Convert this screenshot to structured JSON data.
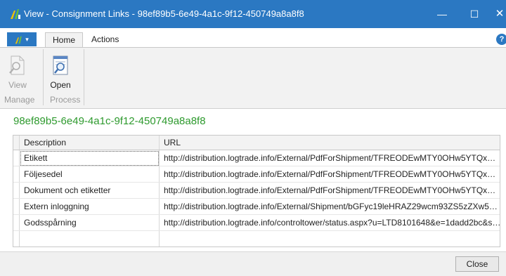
{
  "window": {
    "title": "View - Consignment Links - 98ef89b5-6e49-4a1c-9f12-450749a8a8f8",
    "minimize_glyph": "—",
    "maximize_glyph": "☐",
    "close_glyph": "✕"
  },
  "ribbon": {
    "app_button_caret": "▾",
    "tabs": [
      "Home",
      "Actions"
    ],
    "active_tab": "Home",
    "help_glyph": "?",
    "groups": [
      {
        "label": "Manage",
        "buttons": [
          {
            "label": "View",
            "icon": "document-view-icon",
            "enabled": false
          }
        ]
      },
      {
        "label": "Process",
        "buttons": [
          {
            "label": "Open",
            "icon": "open-link-icon",
            "enabled": true
          }
        ]
      }
    ]
  },
  "record": {
    "id": "98ef89b5-6e49-4a1c-9f12-450749a8a8f8"
  },
  "grid": {
    "columns": [
      "Description",
      "URL"
    ],
    "rows": [
      {
        "description": "Etikett",
        "url": "http://distribution.logtrade.info/External/PdfForShipment/TFREODEwMTY0OHw5YTQxN2I0..."
      },
      {
        "description": "Följesedel",
        "url": "http://distribution.logtrade.info/External/PdfForShipment/TFREODEwMTY0OHw5YTQxN2I0..."
      },
      {
        "description": "Dokument och etiketter",
        "url": "http://distribution.logtrade.info/External/PdfForShipment/TFREODEwMTY0OHw5YTQxN2I0..."
      },
      {
        "description": "Extern inloggning",
        "url": "http://distribution.logtrade.info/External/Shipment/bGFyc19leHRAZ29wcm93ZS5zZXw5YTQ..."
      },
      {
        "description": "Godsspårning",
        "url": "http://distribution.logtrade.info/controltower/status.aspx?u=LTD8101648&e=1dadd2bc&s=6..."
      }
    ],
    "selected_row": 0
  },
  "footer": {
    "close_label": "Close"
  },
  "colors": {
    "titlebar": "#2b78c2",
    "record_id": "#2e9a2e",
    "ribbon_bg": "#f2f2f2"
  }
}
